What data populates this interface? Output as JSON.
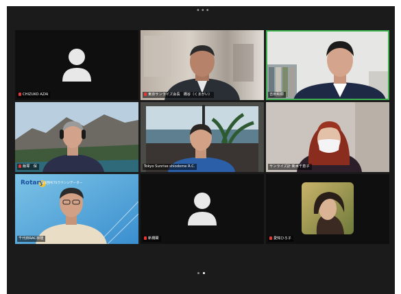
{
  "window": {
    "more_menu": "•••"
  },
  "participants": [
    {
      "name": "CHIZUKO AZAI",
      "video": "off",
      "muted": true
    },
    {
      "name": "東京サンライズ会長　橋谷（くまがい）",
      "video": "on",
      "muted": true
    },
    {
      "name": "吉田和樹",
      "video": "on",
      "muted": false,
      "active_speaker": true
    },
    {
      "name": "飯塚　保",
      "video": "on",
      "muted": true
    },
    {
      "name": "Tokyo Sunrise shiodome R.C.",
      "video": "on",
      "muted": false
    },
    {
      "name": "サンライズ計 新木千恵子",
      "video": "on",
      "muted": false
    },
    {
      "name": "千代田RAC林隆",
      "video": "on",
      "muted": false
    },
    {
      "name": "新橋閣",
      "video": "off",
      "muted": true
    },
    {
      "name": "愛知ひろ子",
      "video": "on",
      "muted": true
    }
  ],
  "banner": {
    "logo_text": "Rotary",
    "caption": "第3回PETSラウンジデーター"
  },
  "pagination": {
    "pages": 2,
    "current": 2
  },
  "colors": {
    "active_border": "#3fb34f",
    "muted_icon": "#e53935",
    "background": "#1b1b1b"
  }
}
